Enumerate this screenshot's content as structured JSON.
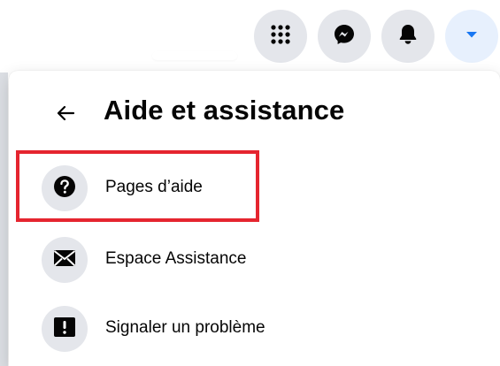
{
  "topbar": {
    "icons": [
      {
        "name": "menu-grid-icon"
      },
      {
        "name": "messenger-icon"
      },
      {
        "name": "notifications-bell-icon"
      },
      {
        "name": "account-caret-icon"
      }
    ]
  },
  "panel": {
    "title": "Aide et assistance",
    "back_icon": "back-arrow-icon",
    "items": [
      {
        "label": "Pages d’aide",
        "icon": "help-question-icon"
      },
      {
        "label": "Espace Assistance",
        "icon": "envelope-icon"
      },
      {
        "label": "Signaler un problème",
        "icon": "report-exclamation-icon"
      }
    ]
  },
  "colors": {
    "highlight": "#e5252f",
    "accent": "#1877f2",
    "icon_bg": "#e4e6eb",
    "text": "#050505"
  }
}
